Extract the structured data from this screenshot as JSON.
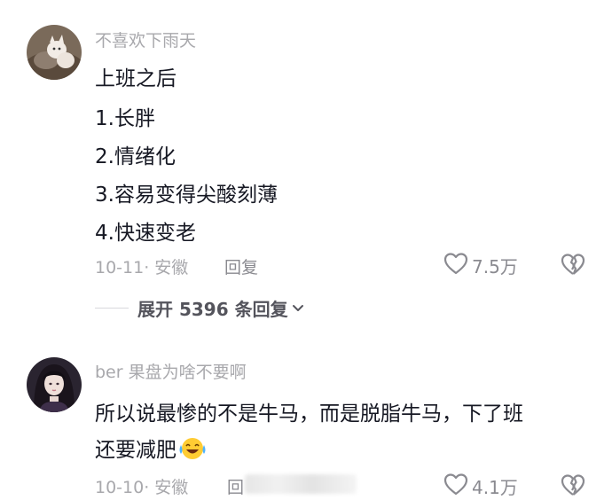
{
  "comments": [
    {
      "username": "不喜欢下雨天",
      "lines": [
        "上班之后",
        "1.长胖",
        "2.情绪化",
        "3.容易变得尖酸刻薄",
        "4.快速变老"
      ],
      "date_location": "10-11· 安徽",
      "reply_label": "回复",
      "likes": "7.5万"
    },
    {
      "username": "ber 果盘为啥不要啊",
      "lines": [
        "所以说最惨的不是牛马，而是脱脂牛马，下了班",
        "还要减肥"
      ],
      "date_location": "10-10· 安徽",
      "reply_label": "回",
      "likes": "4.1万"
    }
  ],
  "expand_replies": "展开 5396 条回复",
  "icons": {
    "like": "heart-outline-icon",
    "dislike": "broken-heart-icon",
    "expand": "chevron-down-icon",
    "emoji": "crying-laughing-emoji"
  }
}
